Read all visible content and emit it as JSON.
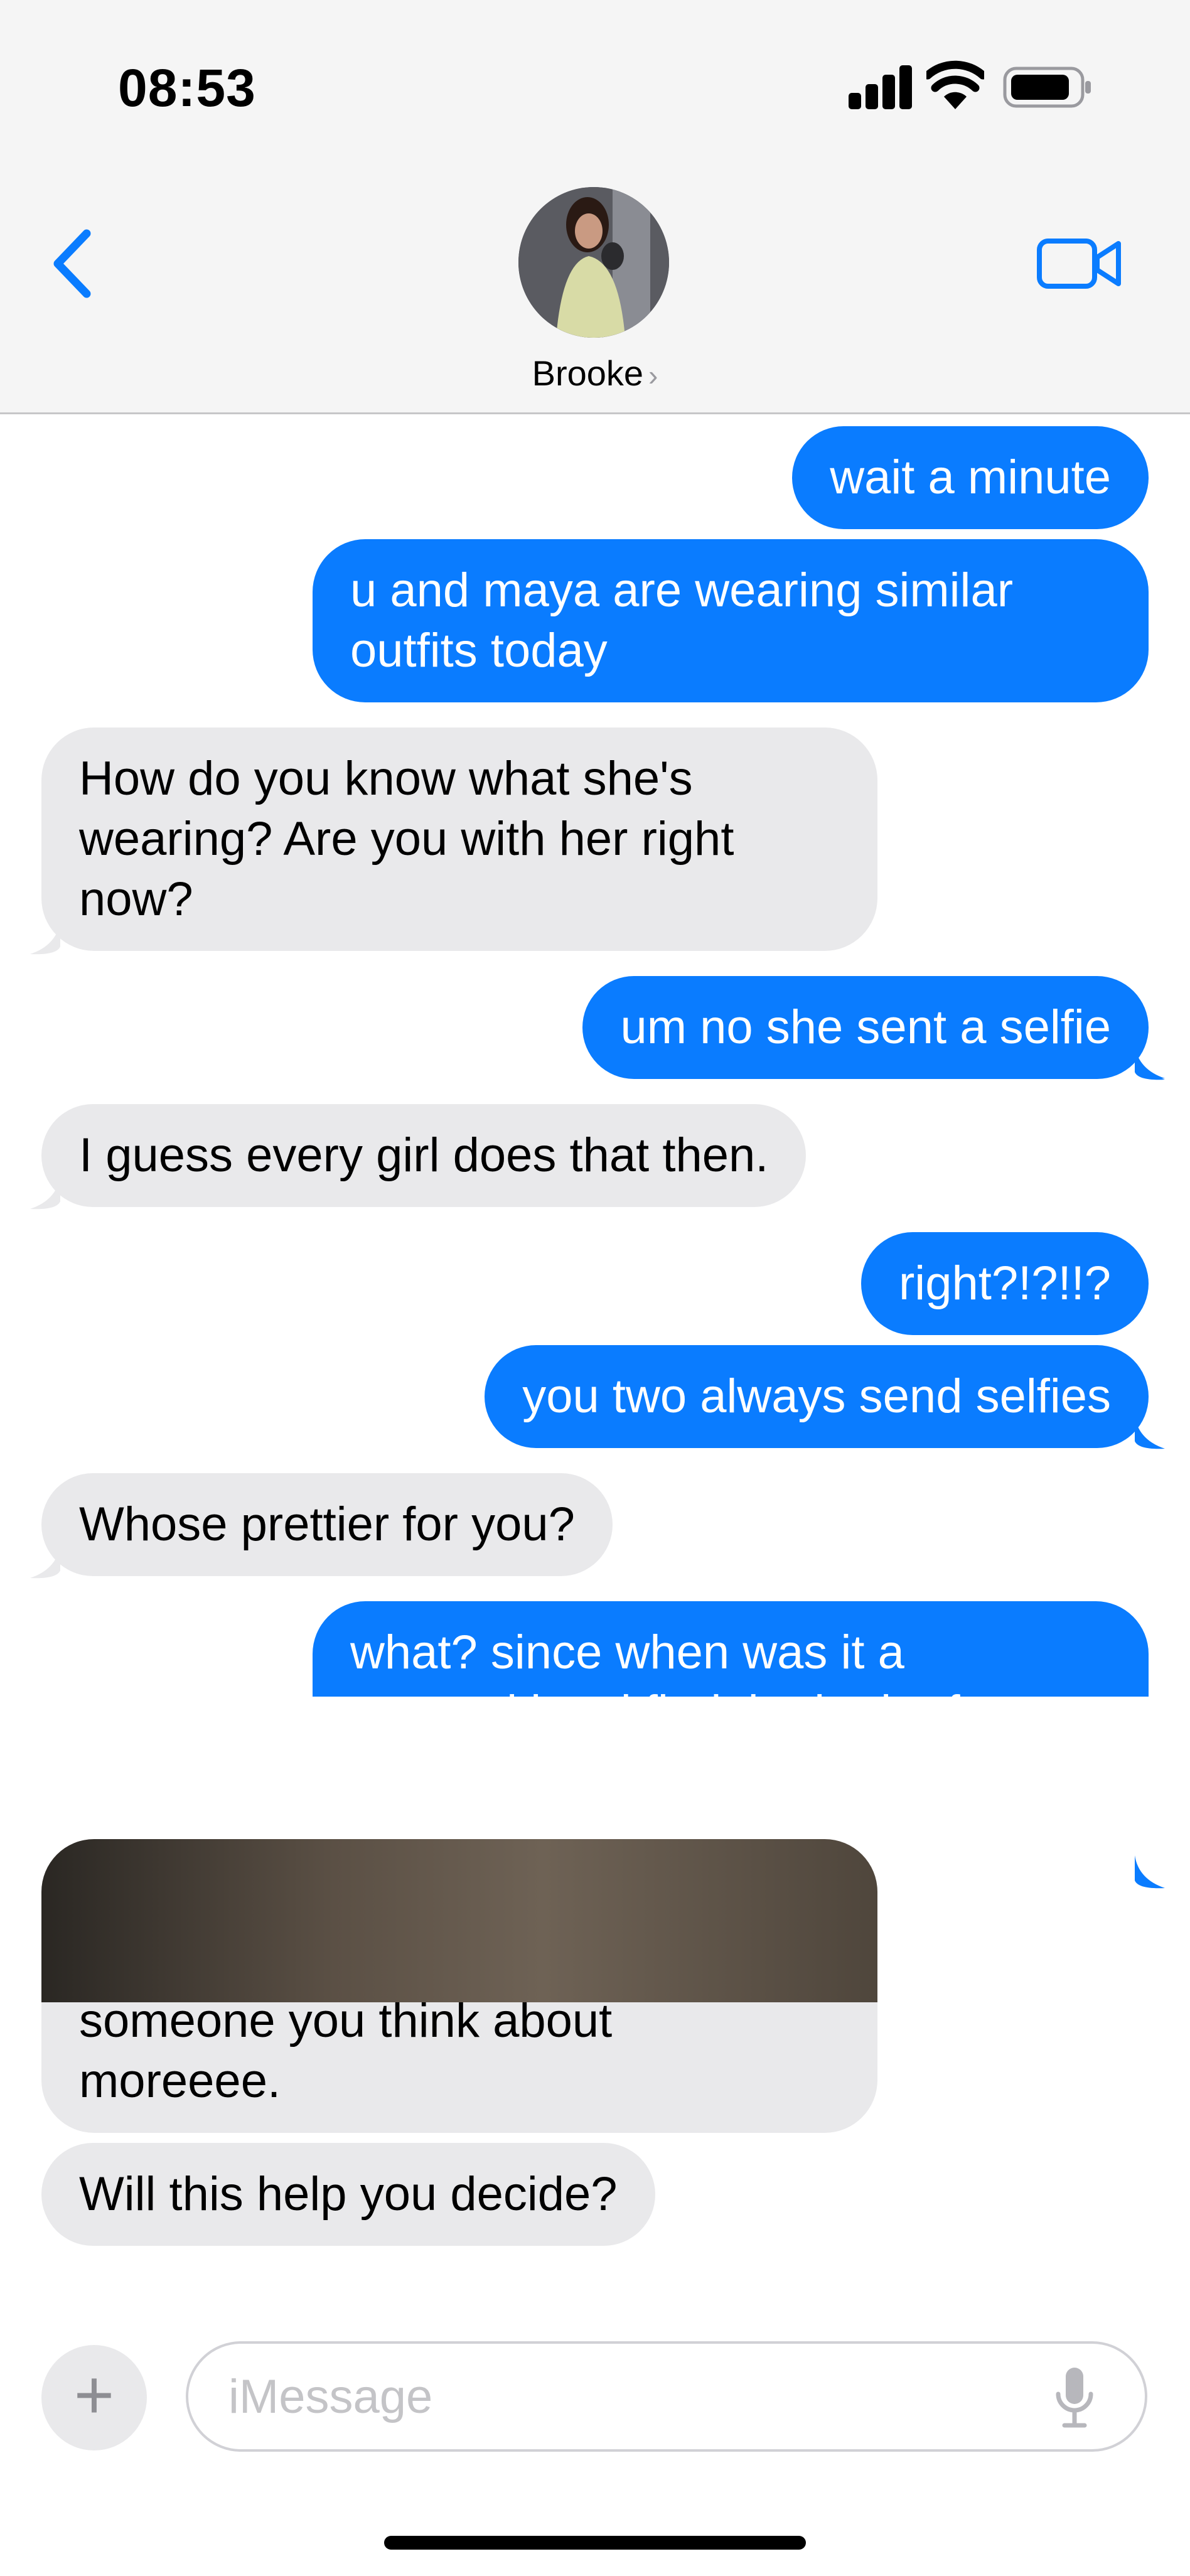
{
  "status_bar": {
    "time": "08:53"
  },
  "header": {
    "contact_name": "Brooke",
    "contact_chevron": "›"
  },
  "messages": [
    {
      "side": "sent",
      "text": "wait a minute"
    },
    {
      "side": "sent",
      "text": "u and maya are wearing similar\noutfits today"
    },
    {
      "side": "received",
      "text": "How do you know what she's\nwearing? Are you with her right\nnow?"
    },
    {
      "side": "sent",
      "text": "um no she sent a selfie"
    },
    {
      "side": "received",
      "text": "I guess every girl does that then."
    },
    {
      "side": "sent",
      "text": "right?!?!!?"
    },
    {
      "side": "sent",
      "text": "you two always send selfies"
    },
    {
      "side": "received",
      "text": "Whose prettier for you?"
    },
    {
      "side": "sent",
      "text": "what? since when was it a\ncompetition, i find the both of\nyou beautiful, theres no more or\nless"
    },
    {
      "side": "received",
      "text": "Oh come onnnn, there's gotta be\nsomeone you think about\nmoreeee."
    },
    {
      "side": "received",
      "text": "Will this help you decide?"
    }
  ],
  "input": {
    "placeholder": "iMessage",
    "plus_label": "+"
  },
  "colors": {
    "sent": "#0a7cff",
    "received": "#e9e9eb",
    "accent": "#0a7cff"
  },
  "icons": [
    "back-chevron-icon",
    "video-camera-icon",
    "signal-icon",
    "wifi-icon",
    "battery-icon",
    "plus-icon",
    "microphone-icon"
  ]
}
